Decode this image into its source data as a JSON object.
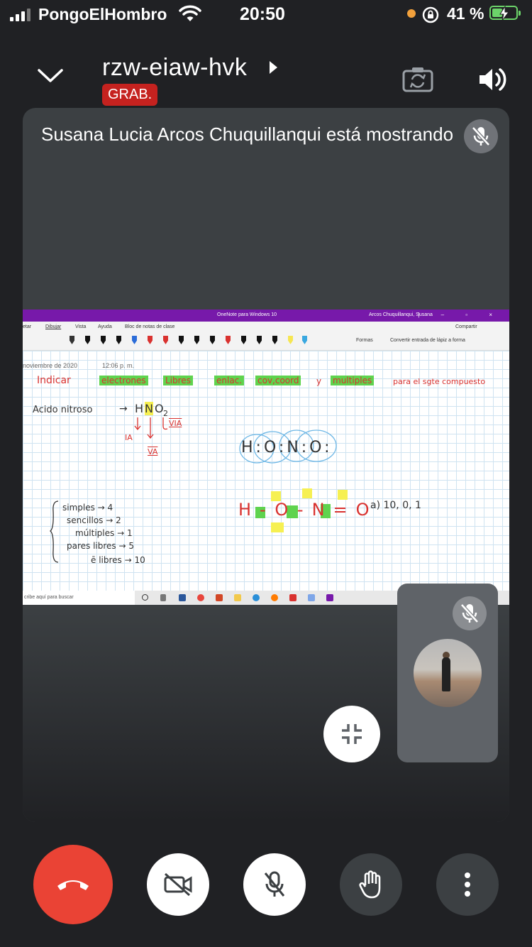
{
  "status_bar": {
    "carrier": "PongoElHombro",
    "time": "20:50",
    "battery": "41 %"
  },
  "header": {
    "meeting_code": "rzw-eiaw-hvk",
    "recording_badge": "GRAB."
  },
  "main_tile": {
    "presenter_text": "Susana Lucia Arcos Chuquillanqui está mostrando"
  },
  "shared_screen": {
    "window_title": "OneNote para Windows 10",
    "window_user": "Arcos Chuquillanqui, Susana",
    "menu": [
      "etar",
      "Dibujar",
      "Vista",
      "Ayuda",
      "Bloc de notas de clase"
    ],
    "share_label": "Compartir",
    "tool_shapes": "Formas",
    "tool_convert": "Convertir entrada de lápiz a forma",
    "date": "noviembre de 2020",
    "time": "12:06 p. m.",
    "taskbar_search": "cribe aquí para buscar",
    "notes": {
      "indicar": "Indicar",
      "electrones": "electrones",
      "libres": "Libres",
      "enlac": "enlac.",
      "cov_coord": "cov,coord",
      "y": "y",
      "multiples": "multiples",
      "para": "para el sgte compuesto",
      "acido": "Acido nitroso",
      "formula_h": "H",
      "formula_n": "N",
      "formula_o": "O",
      "formula_sub": "2",
      "arrow": "→",
      "grp_ia": "IA",
      "grp_va": "VA",
      "grp_via": "VIA",
      "lewis": "H:O:N:O:",
      "struct": "H-O-N=O",
      "answer": "a) 10, 0, 1",
      "simples": "simples → 4",
      "sencillos": "sencillos → 2",
      "multiples_count": "múltiples → 1",
      "pares": "pares libres → 5",
      "e_libres": "ē libres → 10"
    }
  }
}
